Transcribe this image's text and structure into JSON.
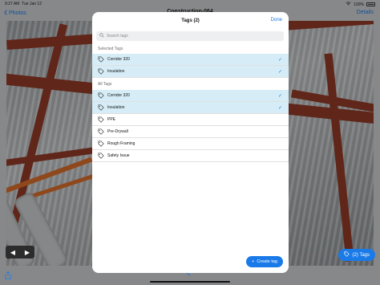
{
  "status_bar": {
    "time": "9:27 AM",
    "date": "Tue Jan 12",
    "battery": "100%"
  },
  "nav": {
    "back_label": "Photos",
    "title": "Construction-064",
    "details_label": "Details"
  },
  "tags_button": {
    "label": "(2) Tags"
  },
  "modal": {
    "title": "Tags (2)",
    "done_label": "Done",
    "search_placeholder": "Search tags",
    "selected_header": "Selected Tags",
    "selected_tags": [
      {
        "label": "Corridor 320"
      },
      {
        "label": "Insulation"
      }
    ],
    "all_header": "All Tags",
    "all_tags": [
      {
        "label": "Corridor 320",
        "selected": true
      },
      {
        "label": "Insulation",
        "selected": true
      },
      {
        "label": "PPE",
        "selected": false
      },
      {
        "label": "Pre-Drywall",
        "selected": false
      },
      {
        "label": "Rough Framing",
        "selected": false
      },
      {
        "label": "Safety Issue",
        "selected": false
      }
    ],
    "create_label": "Create tag"
  },
  "icons": {
    "tag": "tag-icon",
    "check": "checkmark-icon",
    "search": "search-icon",
    "back": "chevron-left-icon",
    "share": "share-icon",
    "plus": "plus-icon",
    "prev": "prev-arrow-icon",
    "next": "next-arrow-icon"
  },
  "colors": {
    "accent": "#1a7ae8",
    "selected_row": "#d6edf7"
  }
}
